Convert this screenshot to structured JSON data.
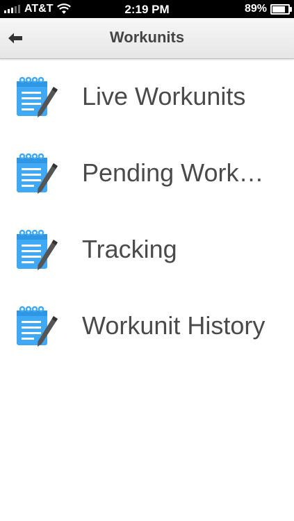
{
  "status_bar": {
    "carrier": "AT&T",
    "time": "2:19 PM",
    "battery": "89%",
    "battery_level": 0.89,
    "signal_bars": 3
  },
  "nav": {
    "title": "Workunits",
    "back_icon": "arrow-left-icon"
  },
  "menu": {
    "icon": "notepad-pencil-icon",
    "accent_color": "#3fa9f5",
    "items": [
      {
        "label": "Live Workunits"
      },
      {
        "label": "Pending Work…"
      },
      {
        "label": "Tracking"
      },
      {
        "label": "Workunit History"
      }
    ]
  }
}
